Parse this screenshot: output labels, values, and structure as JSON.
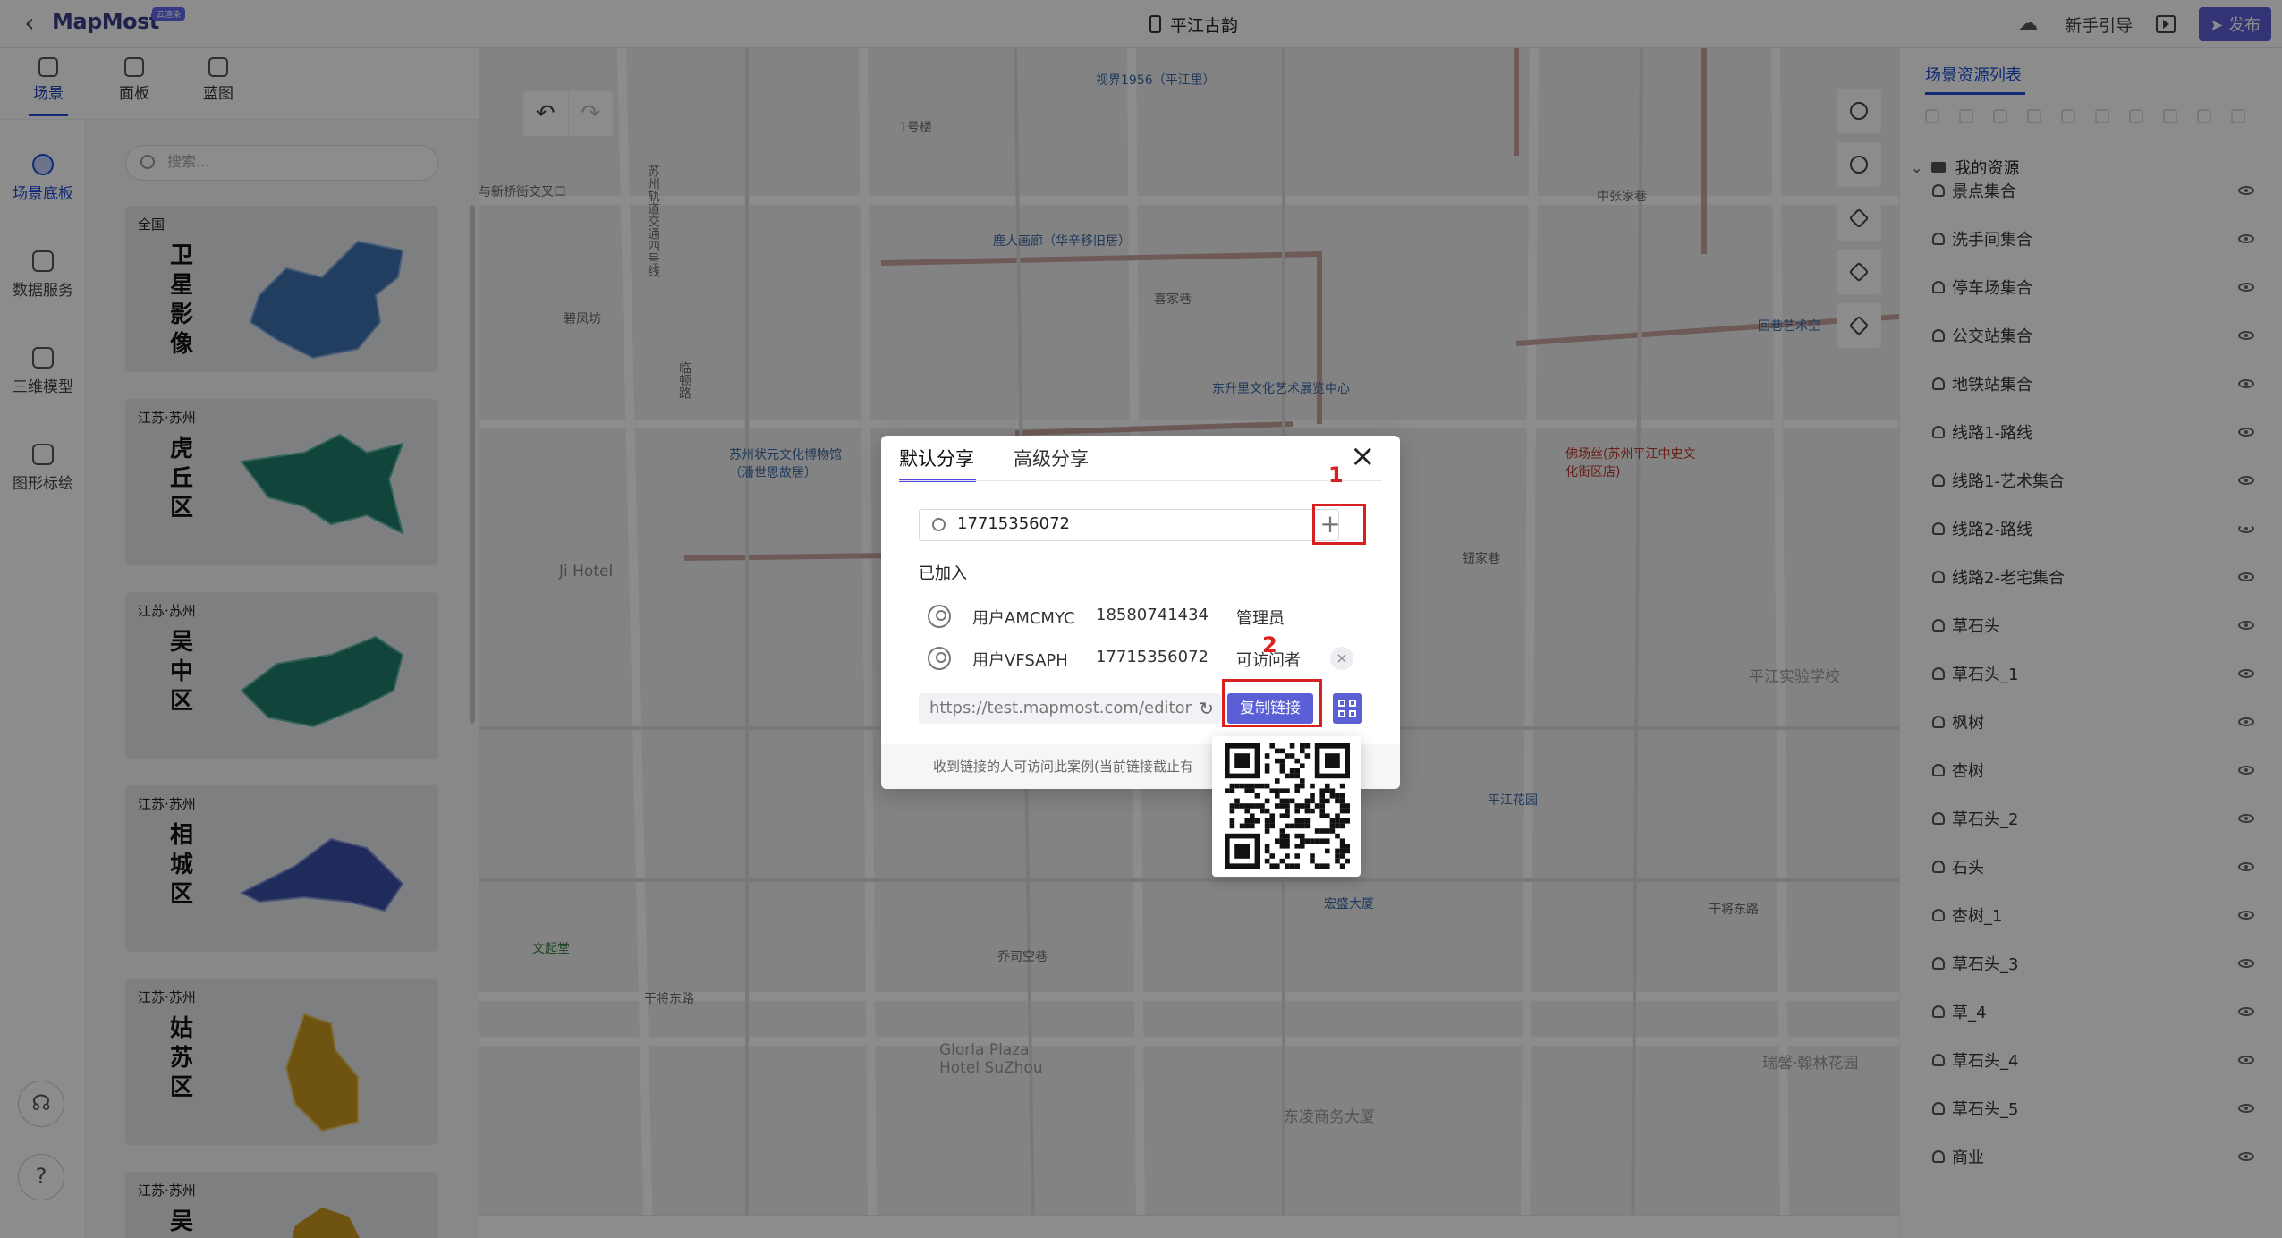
{
  "app": {
    "back_icon": "chevron-left-icon",
    "logo_text": "MapMost",
    "logo_badge": "云渲染",
    "doc_title": "平江古韵",
    "guide_label": "新手引导",
    "publish_label": "发布"
  },
  "top_tabs": [
    {
      "label": "场景",
      "icon": "scene-icon",
      "active": true
    },
    {
      "label": "面板",
      "icon": "panel-icon",
      "active": false
    },
    {
      "label": "蓝图",
      "icon": "blueprint-icon",
      "active": false
    }
  ],
  "rail": [
    {
      "label": "场景底板",
      "icon": "base-icon",
      "active": true
    },
    {
      "label": "数据服务",
      "icon": "database-icon",
      "active": false
    },
    {
      "label": "三维模型",
      "icon": "model-icon",
      "active": false
    },
    {
      "label": "图形标绘",
      "icon": "shapes-icon",
      "active": false
    }
  ],
  "left_panel": {
    "search_placeholder": "搜索...",
    "cards": [
      {
        "region": "全国",
        "name": "卫星影像",
        "color": "#3d6fb0"
      },
      {
        "region": "江苏·苏州",
        "name": "虎丘区",
        "color": "#1f7d6a"
      },
      {
        "region": "江苏·苏州",
        "name": "吴中区",
        "color": "#1f7d6a"
      },
      {
        "region": "江苏·苏州",
        "name": "相城区",
        "color": "#3a4fa6"
      },
      {
        "region": "江苏·苏州",
        "name": "姑苏区",
        "color": "#c99a1e"
      },
      {
        "region": "江苏·苏州",
        "name": "吴",
        "color": "#c99a1e"
      }
    ]
  },
  "map": {
    "labels": [
      {
        "text": "视界1956（平江里）",
        "cls": "blue"
      },
      {
        "text": "1号楼",
        "cls": ""
      },
      {
        "text": "苏州轨道交通四号线",
        "cls": ""
      },
      {
        "text": "与新桥街交叉口",
        "cls": ""
      },
      {
        "text": "鹿人画廊（华辛移旧居）",
        "cls": "blue"
      },
      {
        "text": "喜家巷",
        "cls": ""
      },
      {
        "text": "碧凤坊",
        "cls": ""
      },
      {
        "text": "临顿路",
        "cls": ""
      },
      {
        "text": "东升里文化艺术展览中心",
        "cls": "blue"
      },
      {
        "text": "苏州状元文化博物馆（潘世恩故居）",
        "cls": "blue"
      },
      {
        "text": "中张家巷",
        "cls": ""
      },
      {
        "text": "回巷艺术空",
        "cls": "blue"
      },
      {
        "text": "佛场丝(苏州平江中史文化街区店)",
        "cls": "red"
      },
      {
        "text": "钮家巷",
        "cls": ""
      },
      {
        "text": "Ji Hotel",
        "cls": ""
      },
      {
        "text": "平江实验学校",
        "cls": ""
      },
      {
        "text": "干将东路",
        "cls": ""
      },
      {
        "text": "干将东路",
        "cls": ""
      },
      {
        "text": "文起堂",
        "cls": "green"
      },
      {
        "text": "Glorla Plaza Hotel SuZhou",
        "cls": ""
      },
      {
        "text": "东凌商务大厦",
        "cls": ""
      },
      {
        "text": "瑞馨·翰林花园",
        "cls": ""
      },
      {
        "text": "宏盛大厦",
        "cls": "blue"
      },
      {
        "text": "乔司空巷",
        "cls": ""
      },
      {
        "text": "平江花园",
        "cls": "blue"
      }
    ]
  },
  "right_panel": {
    "title": "场景资源列表",
    "root": "我的资源",
    "items": [
      {
        "label": "景点集合",
        "visible": true
      },
      {
        "label": "洗手间集合",
        "visible": true
      },
      {
        "label": "停车场集合",
        "visible": true
      },
      {
        "label": "公交站集合",
        "visible": true
      },
      {
        "label": "地铁站集合",
        "visible": true
      },
      {
        "label": "线路1-路线",
        "visible": true
      },
      {
        "label": "线路1-艺术集合",
        "visible": true
      },
      {
        "label": "线路2-路线",
        "visible": false
      },
      {
        "label": "线路2-老宅集合",
        "visible": true
      },
      {
        "label": "草石头",
        "visible": true
      },
      {
        "label": "草石头_1",
        "visible": true
      },
      {
        "label": "枫树",
        "visible": true
      },
      {
        "label": "杏树",
        "visible": true
      },
      {
        "label": "草石头_2",
        "visible": true
      },
      {
        "label": "石头",
        "visible": true
      },
      {
        "label": "杏树_1",
        "visible": true
      },
      {
        "label": "草石头_3",
        "visible": true
      },
      {
        "label": "草_4",
        "visible": true
      },
      {
        "label": "草石头_4",
        "visible": true
      },
      {
        "label": "草石头_5",
        "visible": true
      },
      {
        "label": "商业",
        "visible": true
      }
    ]
  },
  "share_dialog": {
    "tab_default": "默认分享",
    "tab_advanced": "高级分享",
    "search_value": "17715356072",
    "joined_label": "已加入",
    "members": [
      {
        "name": "用户AMCMYC",
        "phone": "18580741434",
        "role": "管理员",
        "removable": false
      },
      {
        "name": "用户VFSAPH",
        "phone": "17715356072",
        "role": "可访问者",
        "removable": true
      }
    ],
    "link": "https://test.mapmost.com/editor",
    "copy_label": "复制链接",
    "footer_text": "收到链接的人可访问此案例(当前链接截止有",
    "annot_1": "1",
    "annot_2": "2"
  }
}
